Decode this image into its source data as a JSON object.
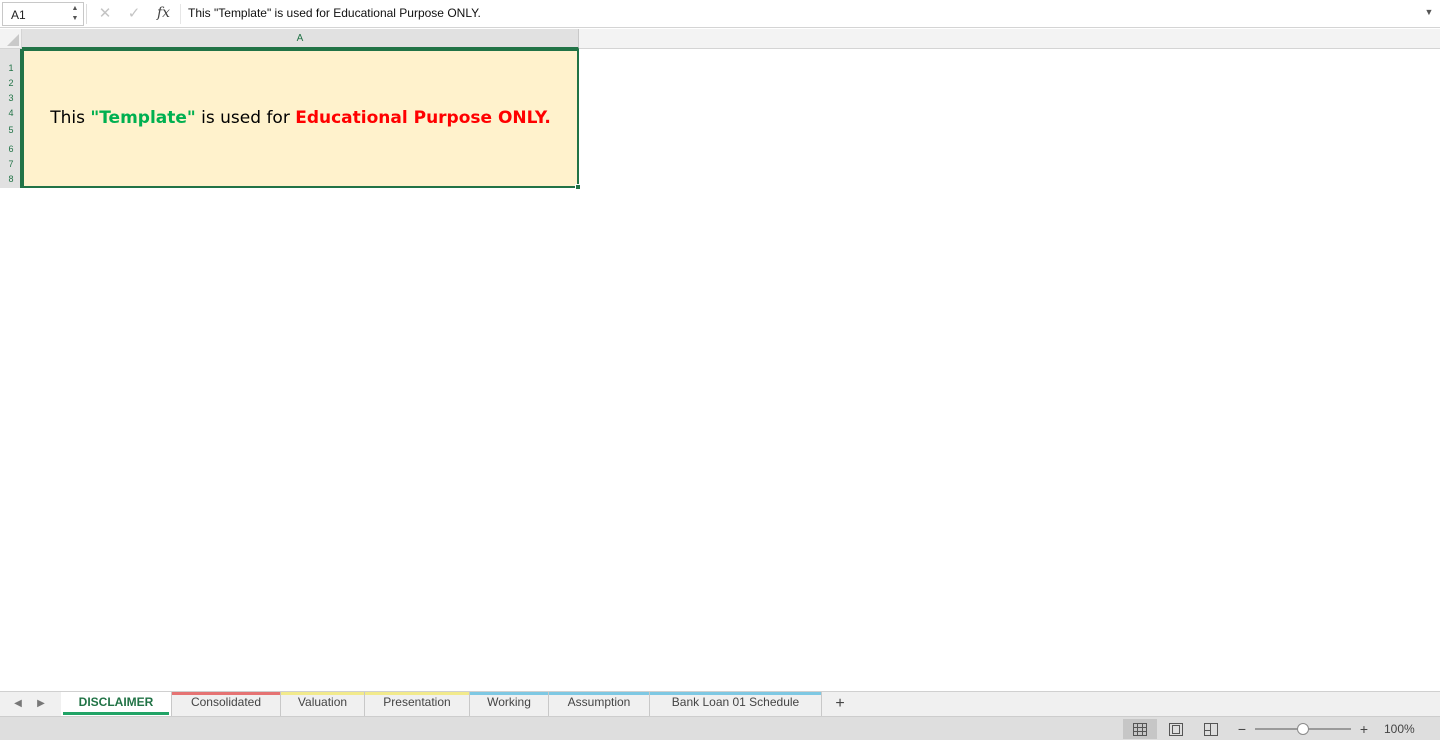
{
  "formula_bar": {
    "name_box": "A1",
    "cancel_icon": "x-icon",
    "enter_icon": "check-icon",
    "fx_label": "fx",
    "content": "This \"Template\" is used for Educational Purpose ONLY."
  },
  "grid": {
    "column_header": "A",
    "row_headers": [
      "1",
      "2",
      "3",
      "4",
      "5",
      "6",
      "7",
      "8"
    ],
    "cell_a1": {
      "part1": "This ",
      "part2": "\"Template\"",
      "part3": " is used for ",
      "part4": "Educational Purpose ONLY.",
      "fill_color": "#fff2cc",
      "green_color": "#00b050",
      "red_color": "#ff0000"
    }
  },
  "sheet_tabs": [
    {
      "label": "DISCLAIMER",
      "color": "#21a366",
      "active": true
    },
    {
      "label": "Consolidated",
      "color": "#e57373"
    },
    {
      "label": "Valuation",
      "color": "#f2ea8c"
    },
    {
      "label": "Presentation",
      "color": "#f2ea8c"
    },
    {
      "label": "Working",
      "color": "#7ec8e3"
    },
    {
      "label": "Assumption",
      "color": "#7ec8e3"
    },
    {
      "label": "Bank Loan 01 Schedule",
      "color": "#7ec8e3"
    }
  ],
  "status_bar": {
    "view_modes": [
      "normal-view-icon",
      "page-layout-icon",
      "page-break-icon"
    ],
    "zoom_level": "100%",
    "zoom_fraction": 0.5
  },
  "theme": {
    "accent": "#217346"
  }
}
